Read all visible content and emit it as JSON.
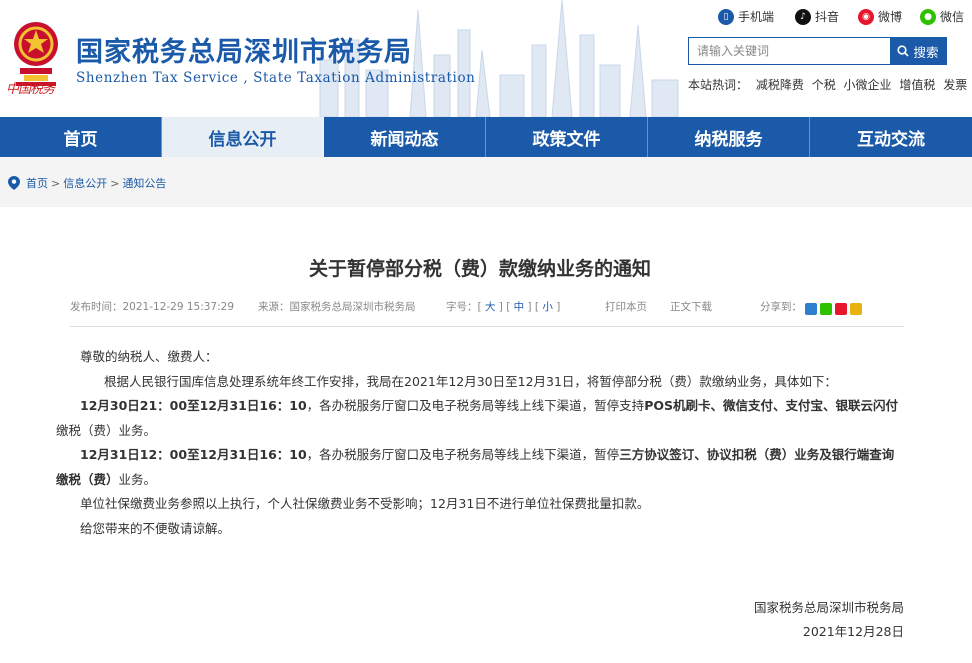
{
  "header": {
    "title": "国家税务总局深圳市税务局",
    "subtitle": "Shenzhen Tax Service , State Taxation Administration",
    "logo_text": "中国税务",
    "social": [
      {
        "label": "手机端",
        "icon": "mobile-icon",
        "color": "#1a5aa8"
      },
      {
        "label": "抖音",
        "icon": "douyin-icon",
        "color": "#111111"
      },
      {
        "label": "微博",
        "icon": "weibo-icon",
        "color": "#e6162d"
      },
      {
        "label": "微信",
        "icon": "wechat-icon",
        "color": "#2dc100"
      }
    ],
    "search": {
      "placeholder": "请输入关键词",
      "button": "搜索"
    },
    "hot_label": "本站热词：",
    "hot_words": [
      "减税降费",
      "个税",
      "小微企业",
      "增值税",
      "发票"
    ]
  },
  "nav": {
    "items": [
      {
        "label": "首页",
        "active": false
      },
      {
        "label": "信息公开",
        "active": true
      },
      {
        "label": "新闻动态",
        "active": false
      },
      {
        "label": "政策文件",
        "active": false
      },
      {
        "label": "纳税服务",
        "active": false
      },
      {
        "label": "互动交流",
        "active": false
      }
    ]
  },
  "breadcrumb": [
    "首页",
    "信息公开",
    "通知公告"
  ],
  "article": {
    "title": "关于暂停部分税（费）款缴纳业务的通知",
    "publish_time": "发布时间：2021-12-29 15:37:29",
    "source": "来源：国家税务总局深圳市税务局",
    "font_size_label": "字号：",
    "font_sizes": [
      "大",
      "中",
      "小"
    ],
    "print": "打印本页",
    "download": "正文下载",
    "share_label": "分享到：",
    "paragraphs": {
      "greeting": "尊敬的纳税人、缴费人：",
      "intro": "根据人民银行国库信息处理系统年终工作安排，我局在2021年12月30日至12月31日，将暂停部分税（费）款缴纳业务，具体如下：",
      "p1_bold": "12月30日21：00至12月31日16：10",
      "p1_mid": "，各办税服务厅窗口及电子税务局等线上线下渠道，暂停支持",
      "p1_bold2": "POS机刷卡、微信支付、支付宝、银联云闪付",
      "p1_tail": "缴税（费）业务。",
      "p2_bold": "12月31日12：00至12月31日16：10",
      "p2_mid": "，各办税服务厅窗口及电子税务局等线上线下渠道，暂停",
      "p2_bold2": "三方协议签订、协议扣税（费）业务及银行端查询",
      "p2_tail_bold": "缴税（费）",
      "p2_tail": "业务。",
      "p3": "单位社保缴费业务参照以上执行，个人社保缴费业务不受影响；12月31日不进行单位社保费批量扣款。",
      "p4": "给您带来的不便敬请谅解。"
    },
    "signature": "国家税务总局深圳市税务局",
    "date": "2021年12月28日"
  }
}
